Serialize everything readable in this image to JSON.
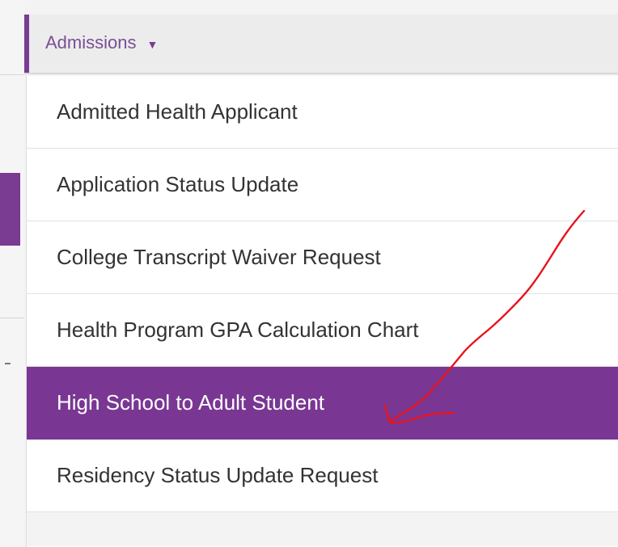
{
  "nav": {
    "admissions_label": "Admissions",
    "caret": "▼"
  },
  "menu": {
    "items": [
      {
        "label": "Admitted Health Applicant",
        "active": false
      },
      {
        "label": "Application Status Update",
        "active": false
      },
      {
        "label": "College Transcript Waiver Request",
        "active": false
      },
      {
        "label": "Health Program GPA Calculation Chart",
        "active": false
      },
      {
        "label": "High School to Adult Student",
        "active": true
      },
      {
        "label": "Residency Status Update Request",
        "active": false
      }
    ]
  },
  "colors": {
    "accent_purple": "#793793",
    "annotation_red": "#e8131e"
  }
}
